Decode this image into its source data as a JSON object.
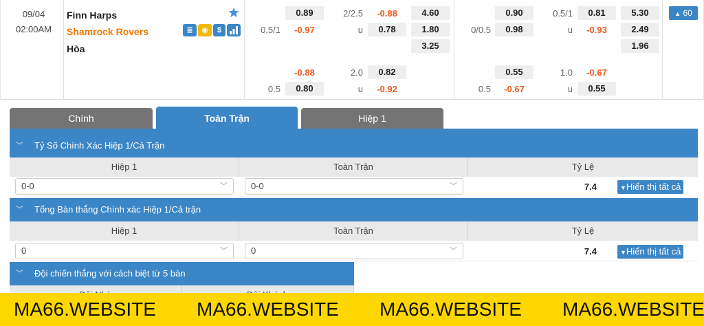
{
  "match": {
    "date": "09/04",
    "time": "02:00AM",
    "home_team": "Finn Harps",
    "away_team": "Shamrock Rovers",
    "draw_label": "Hòa",
    "more_button_label": "60",
    "icons": [
      "star-icon",
      "stats-icon",
      "coin-icon",
      "dollar-icon",
      "chart-icon"
    ]
  },
  "odds": {
    "ft": {
      "main": {
        "home_val": "0.89",
        "away_line": "0.5/1",
        "away_val": "-0.97",
        "ou_line": "2/2.5",
        "ou_over": "-0.88",
        "ou_under_label": "u",
        "ou_under": "0.78",
        "x12_home": "4.60",
        "x12_away": "1.80",
        "x12_draw": "3.25"
      },
      "alt": {
        "home_val": "-0.88",
        "away_line": "0.5",
        "away_val": "0.80",
        "ou_line": "2.0",
        "ou_over": "0.82",
        "ou_under_label": "u",
        "ou_under": "-0.92"
      }
    },
    "h1": {
      "main": {
        "home_val": "0.90",
        "away_line": "0/0.5",
        "away_val": "0.98",
        "ou_line": "0.5/1",
        "ou_over": "0.81",
        "ou_under_label": "u",
        "ou_under": "-0.93",
        "x12_home": "5.30",
        "x12_away": "2.49",
        "x12_draw": "1.96"
      },
      "alt": {
        "home_val": "0.55",
        "away_line": "0.5",
        "away_val": "-0.67",
        "ou_line": "1.0",
        "ou_over": "-0.67",
        "ou_under_label": "u",
        "ou_under": "0.55"
      }
    }
  },
  "tabs": [
    {
      "label": "Chính",
      "active": false
    },
    {
      "label": "Toàn Trận",
      "active": true
    },
    {
      "label": "Hiệp 1",
      "active": false
    }
  ],
  "sections": {
    "exact_score": {
      "title": "Tỷ Số Chính Xác Hiệp 1/Cả Trận",
      "col_headers": [
        "Hiệp 1",
        "Toàn Trận",
        "Tỷ Lệ"
      ],
      "select1": "0-0",
      "select2": "0-0",
      "rate": "7.4",
      "show_all": "Hiển thị tất cả"
    },
    "total_goals": {
      "title": "Tổng Bàn thắng Chính xác Hiệp 1/Cả trận",
      "col_headers": [
        "Hiệp 1",
        "Toàn Trận",
        "Tỷ Lệ"
      ],
      "select1": "0",
      "select2": "0",
      "rate": "7.4",
      "show_all": "Hiển thị tất cả"
    },
    "winning_margin": {
      "title": "Đội chiến thắng với cách biệt từ 5 bàn",
      "col_headers": [
        "Đội Nhà",
        "Đội Khách"
      ]
    }
  },
  "banner": {
    "texts": [
      "MA66.WEBSITE",
      "MA66.WEBSITE",
      "MA66.WEBSITE",
      "MA66.WEBSITE"
    ],
    "color": "#ffd700"
  },
  "colors": {
    "accent": "#3b86c6",
    "negative": "#ef5a1e",
    "favorite_team": "#f07800",
    "inactive_tab": "#747474"
  }
}
